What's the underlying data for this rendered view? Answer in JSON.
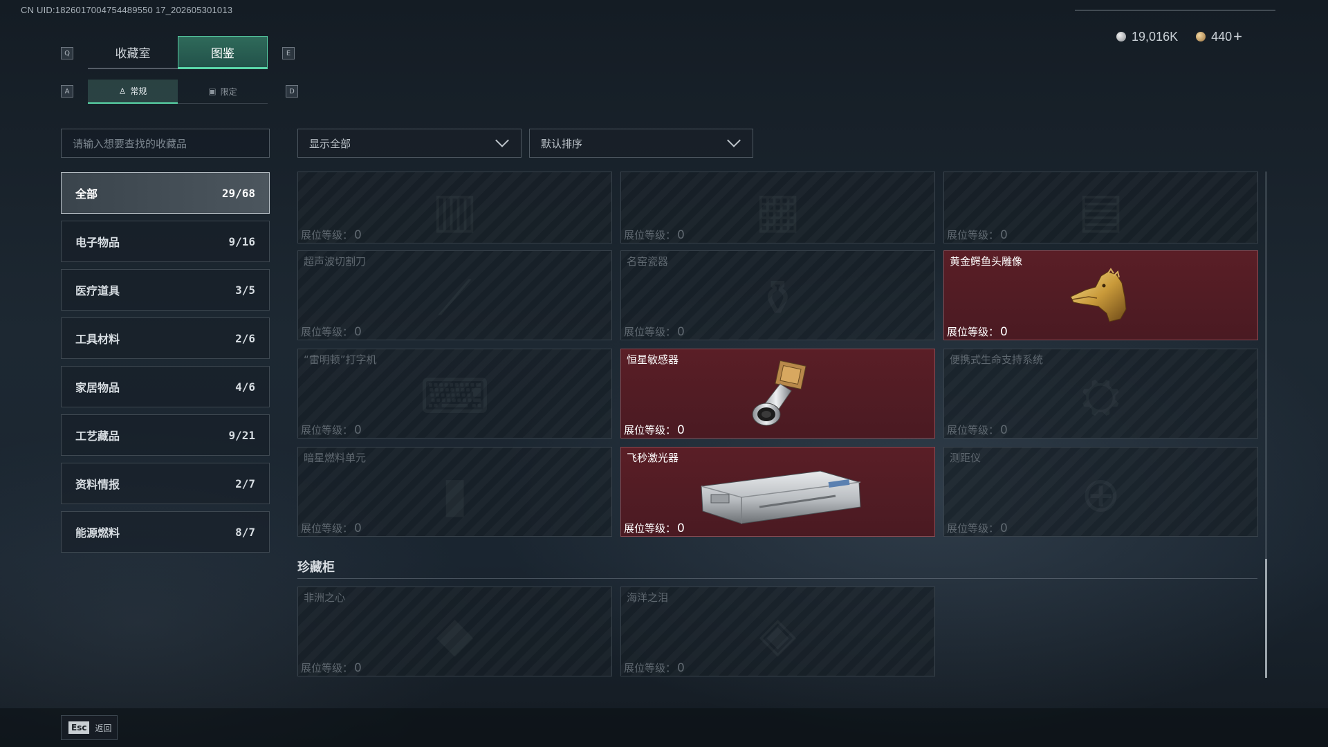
{
  "uid_text": "CN UID:1826017004754489550 17_202605301013",
  "currency": {
    "silver": "19,016K",
    "gold": "440",
    "plus": "+"
  },
  "keyhints": {
    "q": "Q",
    "e": "E",
    "a": "A",
    "d": "D"
  },
  "tabs": [
    {
      "label": "收藏室"
    },
    {
      "label": "图鉴"
    }
  ],
  "subtabs": [
    {
      "label": "常规"
    },
    {
      "label": "限定"
    }
  ],
  "search": {
    "placeholder": "请输入想要查找的收藏品"
  },
  "filters": {
    "show": "显示全部",
    "sort": "默认排序"
  },
  "categories": [
    {
      "label": "全部",
      "count": "29/68"
    },
    {
      "label": "电子物品",
      "count": "9/16"
    },
    {
      "label": "医疗道具",
      "count": "3/5"
    },
    {
      "label": "工具材料",
      "count": "2/6"
    },
    {
      "label": "家居物品",
      "count": "4/6"
    },
    {
      "label": "工艺藏品",
      "count": "9/21"
    },
    {
      "label": "资料情报",
      "count": "2/7"
    },
    {
      "label": "能源燃料",
      "count": "8/7"
    }
  ],
  "level_label": "展位等级：",
  "items": [
    {
      "name": "",
      "level": "0",
      "owned": false
    },
    {
      "name": "",
      "level": "0",
      "owned": false
    },
    {
      "name": "",
      "level": "0",
      "owned": false
    },
    {
      "name": "超声波切割刀",
      "level": "0",
      "owned": false
    },
    {
      "name": "名窑瓷器",
      "level": "0",
      "owned": false
    },
    {
      "name": "黄金鳄鱼头雕像",
      "level": "0",
      "owned": true,
      "icon": "golden-crocodile-head-icon"
    },
    {
      "name": "“雷明顿”打字机",
      "level": "0",
      "owned": false
    },
    {
      "name": "恒星敏感器",
      "level": "0",
      "owned": true,
      "icon": "star-sensor-icon"
    },
    {
      "name": "便携式生命支持系统",
      "level": "0",
      "owned": false
    },
    {
      "name": "暗星燃料单元",
      "level": "0",
      "owned": false
    },
    {
      "name": "飞秒激光器",
      "level": "0",
      "owned": true,
      "icon": "femtosecond-laser-icon"
    },
    {
      "name": "测距仪",
      "level": "0",
      "owned": false
    }
  ],
  "section": {
    "title": "珍藏柜"
  },
  "treasures": [
    {
      "name": "非洲之心",
      "level": "0",
      "owned": false
    },
    {
      "name": "海洋之泪",
      "level": "0",
      "owned": false
    }
  ],
  "footer": {
    "esc_key": "Esc",
    "esc_label": "返回"
  },
  "colors": {
    "accent": "#5ad6a8",
    "owned_card": "#5a1e26",
    "bg": "#1d2832"
  }
}
